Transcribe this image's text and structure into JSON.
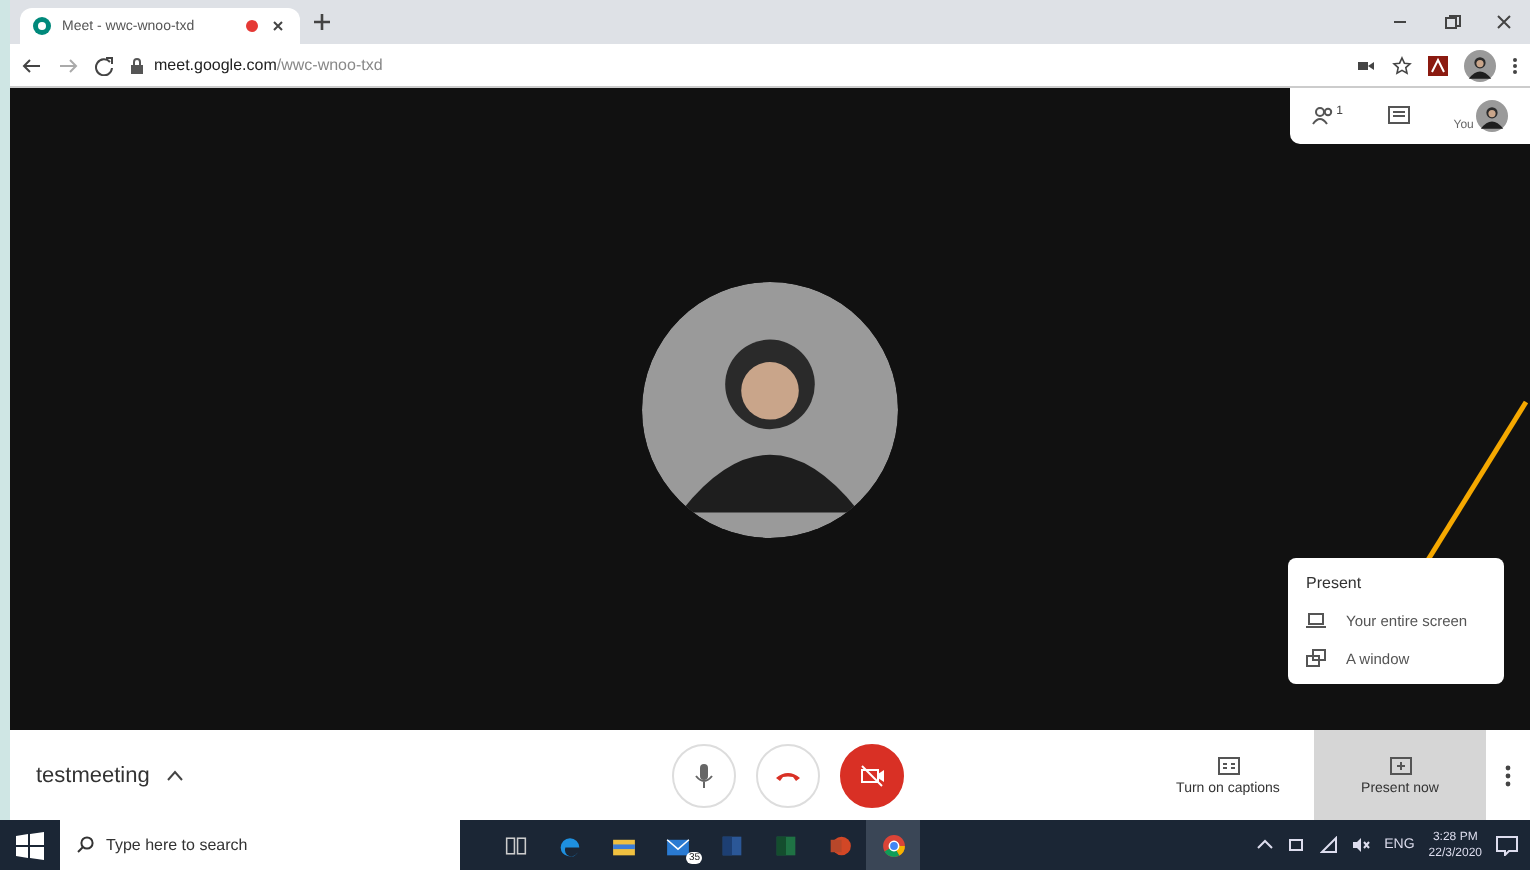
{
  "browser": {
    "tab": {
      "title": "Meet - wwc-wnoo-txd",
      "recording": true
    },
    "url": {
      "host": "meet.google.com",
      "path": "/wwc-wnoo-txd"
    }
  },
  "meet": {
    "top_panel": {
      "participants_count": "1",
      "you_label": "You"
    },
    "present_menu": {
      "title": "Present",
      "items": [
        {
          "kind": "screen",
          "label": "Your entire screen"
        },
        {
          "kind": "window",
          "label": "A window"
        }
      ]
    },
    "bottom_bar": {
      "meeting_name": "testmeeting",
      "controls": [
        {
          "kind": "mic",
          "muted": false
        },
        {
          "kind": "hangup",
          "muted": false
        },
        {
          "kind": "camera",
          "muted": true
        }
      ],
      "actions": [
        {
          "kind": "captions",
          "label": "Turn on captions",
          "selected": false
        },
        {
          "kind": "present",
          "label": "Present now",
          "selected": true
        }
      ]
    }
  },
  "taskbar": {
    "search": {
      "placeholder": "Type here to search"
    },
    "apps": [
      {
        "kind": "taskview",
        "selected": false
      },
      {
        "kind": "edge",
        "selected": false
      },
      {
        "kind": "explorer",
        "selected": false
      },
      {
        "kind": "mail",
        "badge": "35",
        "selected": false
      },
      {
        "kind": "word",
        "selected": false
      },
      {
        "kind": "excel",
        "selected": false
      },
      {
        "kind": "powerpoint",
        "selected": false
      },
      {
        "kind": "chrome",
        "selected": true
      }
    ],
    "tray": {
      "language": "ENG",
      "time": "3:28 PM",
      "date": "22/3/2020"
    }
  }
}
